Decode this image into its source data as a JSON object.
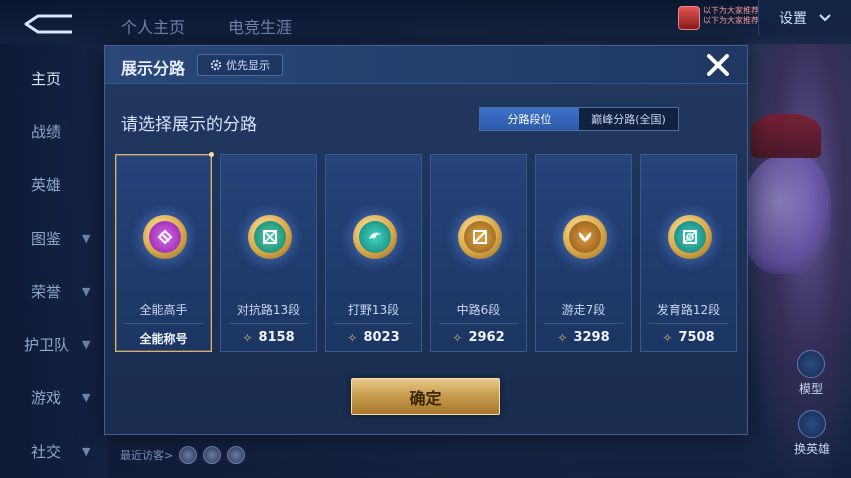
{
  "top": {
    "tabs": [
      "个人主页",
      "电竞生涯"
    ],
    "settings_label": "设置",
    "badge_text_line1": "以下为大家推荐",
    "badge_text_line2": "以下为大家推荐"
  },
  "sidebar": {
    "items": [
      {
        "label": "主页",
        "chevron": false,
        "active": true
      },
      {
        "label": "战绩",
        "chevron": false
      },
      {
        "label": "英雄",
        "chevron": false
      },
      {
        "label": "图鉴",
        "chevron": true
      },
      {
        "label": "荣誉",
        "chevron": true
      },
      {
        "label": "护卫队",
        "chevron": true
      },
      {
        "label": "游戏",
        "chevron": true
      },
      {
        "label": "社交",
        "chevron": true
      }
    ]
  },
  "footer": {
    "visitors_label": "最近访客>"
  },
  "right_panel": {
    "model_label": "模型",
    "swap_label": "换英雄"
  },
  "modal": {
    "title": "展示分路",
    "priority_label": "优先显示",
    "subtitle": "请选择展示的分路",
    "tabs": [
      {
        "label": "分路段位",
        "active": true
      },
      {
        "label": "巅峰分路(全国)",
        "active": false
      }
    ],
    "cards": [
      {
        "name": "全能高手",
        "value": "全能称号",
        "selected": true,
        "color": "#b23cc8",
        "icon": "all-round-icon"
      },
      {
        "name": "对抗路13段",
        "value": "8158",
        "selected": false,
        "color": "#2aa98a",
        "icon": "clash-lane-icon"
      },
      {
        "name": "打野13段",
        "value": "8023",
        "selected": false,
        "color": "#1fa295",
        "icon": "jungle-icon"
      },
      {
        "name": "中路6段",
        "value": "2962",
        "selected": false,
        "color": "#c2892d",
        "icon": "mid-lane-icon"
      },
      {
        "name": "游走7段",
        "value": "3298",
        "selected": false,
        "color": "#b9792a",
        "icon": "roam-icon"
      },
      {
        "name": "发育路12段",
        "value": "7508",
        "selected": false,
        "color": "#2aa39a",
        "icon": "farm-lane-icon"
      }
    ],
    "confirm_label": "确定"
  },
  "colors": {
    "accent_blue": "#2b5aa8",
    "gold": "#d9b46a",
    "modal_bg": "#1d3257"
  }
}
